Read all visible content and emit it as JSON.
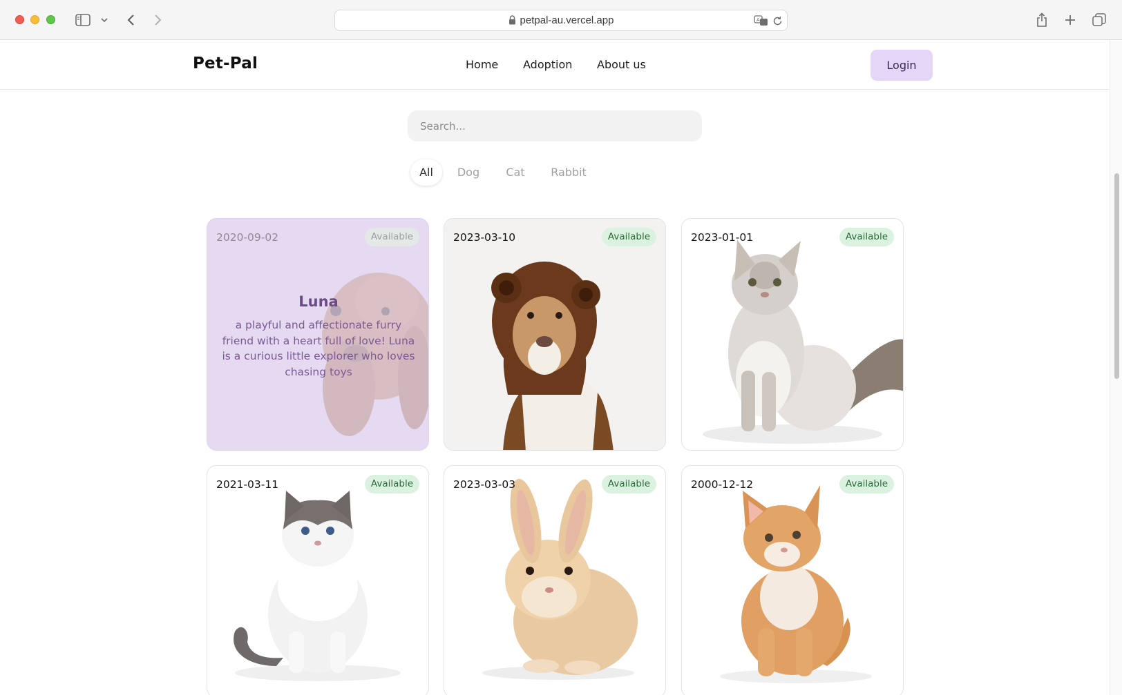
{
  "browser": {
    "url": "petpal-au.vercel.app"
  },
  "header": {
    "logo": "Pet-Pal",
    "nav": [
      "Home",
      "Adoption",
      "About us"
    ],
    "login_label": "Login"
  },
  "search": {
    "placeholder": "Search..."
  },
  "filters": {
    "items": [
      "All",
      "Dog",
      "Cat",
      "Rabbit"
    ],
    "selected": "All"
  },
  "pets": [
    {
      "date": "2020-09-02",
      "status": "Available",
      "name": "Luna",
      "description": "a playful and affectionate furry friend with a heart full of love! Luna is a curious little explorer who loves chasing toys",
      "animal": "dog"
    },
    {
      "date": "2023-03-10",
      "status": "Available",
      "animal": "dog"
    },
    {
      "date": "2023-01-01",
      "status": "Available",
      "animal": "cat"
    },
    {
      "date": "2021-03-11",
      "status": "Available",
      "animal": "cat"
    },
    {
      "date": "2023-03-03",
      "status": "Available",
      "animal": "rabbit"
    },
    {
      "date": "2000-12-12",
      "status": "Available",
      "animal": "cat"
    }
  ],
  "colors": {
    "login_bg": "#e3d6f6",
    "badge_bg": "#dcf2e1",
    "badge_text": "#2b6a3a",
    "hover_overlay": "#e2d6f0"
  }
}
